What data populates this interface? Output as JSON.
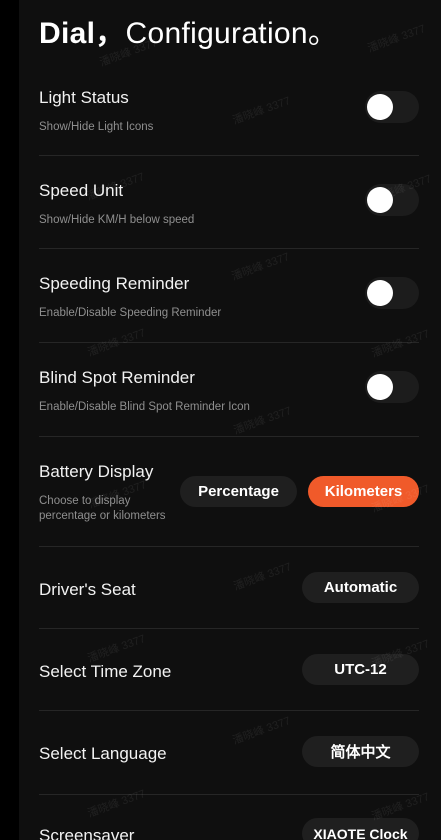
{
  "header": {
    "title_bold": "Dial，",
    "title_light": "Configuration。"
  },
  "settings": [
    {
      "label": "Light Status",
      "description": "Show/Hide Light Icons",
      "toggle_on": false
    },
    {
      "label": "Speed Unit",
      "description": "Show/Hide KM/H below speed",
      "toggle_on": false
    },
    {
      "label": "Speeding Reminder",
      "description": "Enable/Disable Speeding Reminder",
      "toggle_on": false
    },
    {
      "label": "Blind Spot Reminder",
      "description": "Enable/Disable Blind Spot Reminder Icon",
      "toggle_on": false
    }
  ],
  "battery": {
    "label": "Battery Display",
    "description": "Choose to display percentage or kilometers",
    "options": [
      "Percentage",
      "Kilometers"
    ],
    "selected": "Kilometers"
  },
  "drivers_seat": {
    "label": "Driver's Seat",
    "value": "Automatic"
  },
  "time_zone": {
    "label": "Select Time Zone",
    "value": "UTC-12"
  },
  "language": {
    "label": "Select Language",
    "value": "简体中文"
  },
  "screensaver": {
    "label": "Screensaver",
    "value": "XIAOTE Clock"
  },
  "watermark": "潘晓峰 3377",
  "colors": {
    "accent": "#f05a2a",
    "toggle_off": "#1c1c1c",
    "pill": "#1f1f1f",
    "background": "#0f0f0f"
  }
}
